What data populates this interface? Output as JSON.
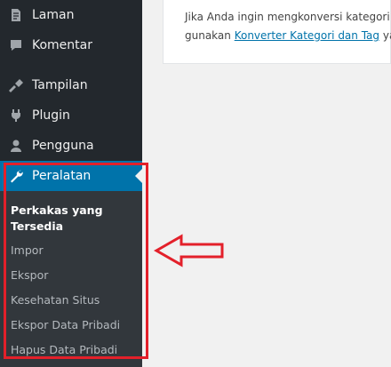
{
  "sidebar": {
    "items": [
      {
        "label": "Laman",
        "icon": "pages-icon"
      },
      {
        "label": "Komentar",
        "icon": "comments-icon"
      },
      {
        "label": "Tampilan",
        "icon": "appearance-icon"
      },
      {
        "label": "Plugin",
        "icon": "plugins-icon"
      },
      {
        "label": "Pengguna",
        "icon": "users-icon"
      },
      {
        "label": "Peralatan",
        "icon": "tools-icon",
        "active": true
      }
    ],
    "submenu": [
      "Perkakas yang Tersedia",
      "Impor",
      "Ekspor",
      "Kesehatan Situs",
      "Ekspor Data Pribadi",
      "Hapus Data Pribadi"
    ]
  },
  "content": {
    "line1": "Jika Anda ingin mengkonversi kategori A",
    "line2_prefix": "gunakan ",
    "link": "Konverter Kategori dan Tag",
    "line2_suffix": " yar"
  },
  "colors": {
    "sidebar_bg": "#23282d",
    "submenu_bg": "#32373c",
    "active_bg": "#0073aa",
    "annotation": "#e3202a"
  }
}
